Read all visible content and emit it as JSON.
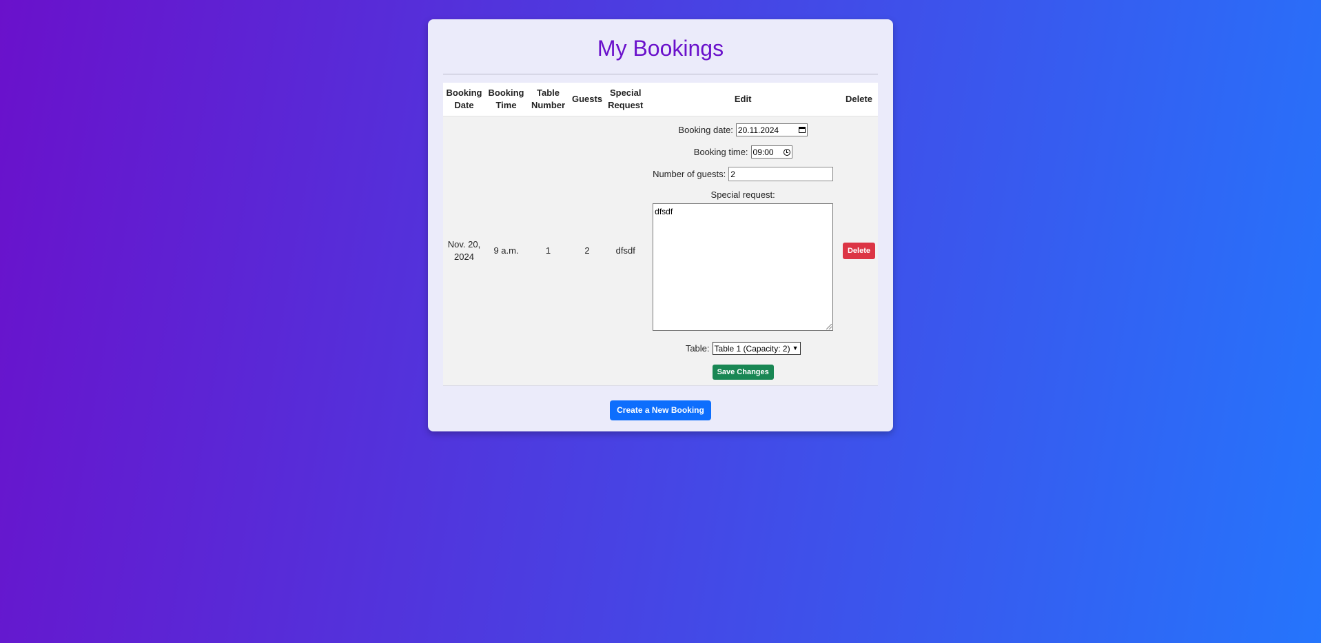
{
  "page": {
    "title": "My Bookings"
  },
  "table": {
    "headers": {
      "booking_date": "Booking Date",
      "booking_time": "Booking Time",
      "table_number": "Table Number",
      "guests": "Guests",
      "special_request": "Special Request",
      "edit": "Edit",
      "delete": "Delete"
    },
    "rows": [
      {
        "booking_date": "Nov. 20, 2024",
        "booking_time": "9 a.m.",
        "table_number": "1",
        "guests": "2",
        "special_request": "dfsdf",
        "edit_form": {
          "date_label": "Booking date:",
          "date_value": "20.11.2024",
          "time_label": "Booking time:",
          "time_value": "09:00",
          "guests_label": "Number of guests:",
          "guests_value": "2",
          "request_label": "Special request:",
          "request_value": "dfsdf",
          "table_label": "Table:",
          "table_selected": "Table 1 (Capacity: 2)",
          "save_label": "Save Changes"
        },
        "delete_label": "Delete"
      }
    ]
  },
  "actions": {
    "create_label": "Create a New Booking"
  },
  "colors": {
    "title": "#6a11cb",
    "save": "#198754",
    "delete": "#dc3545",
    "create": "#0d6efd",
    "gradient_start": "#6a11cb",
    "gradient_end": "#2575fc"
  },
  "icons": {
    "date": "calendar-icon",
    "time": "clock-icon",
    "select": "chevron-down-icon"
  }
}
